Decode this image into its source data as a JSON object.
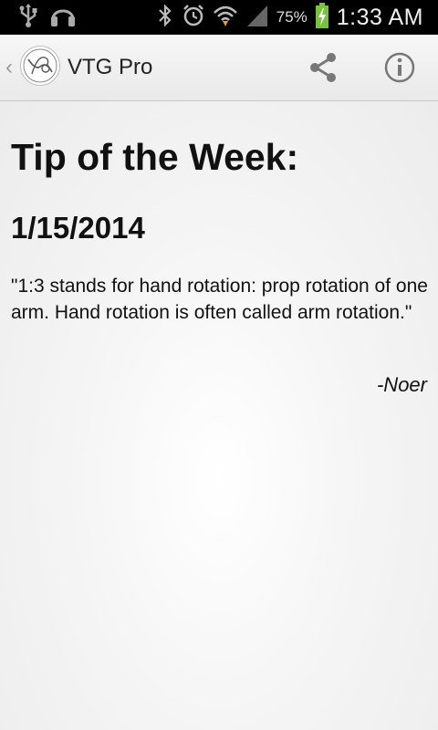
{
  "status_bar": {
    "icons": [
      "usb-icon",
      "headphones-icon",
      "bluetooth-icon",
      "alarm-icon",
      "wifi-icon",
      "signal-icon",
      "battery-charging-icon"
    ],
    "battery": "75%",
    "time": "1:33 AM"
  },
  "action_bar": {
    "title": "VTG Pro",
    "up_caret": "‹",
    "actions": [
      "share-icon",
      "info-icon"
    ]
  },
  "tip": {
    "heading": "Tip of the Week:",
    "date": "1/15/2014",
    "quote": "\"1:3 stands for hand rotation: prop rotation of one arm. Hand rotation is often called arm rotation.\"",
    "author": "-Noer"
  },
  "colors": {
    "status_bar": "#000000",
    "action_bar": "#efefef",
    "background": "#f4f4f4",
    "text": "#111111",
    "icon_gray": "#6b6b6b",
    "battery_green": "#7ac142"
  }
}
